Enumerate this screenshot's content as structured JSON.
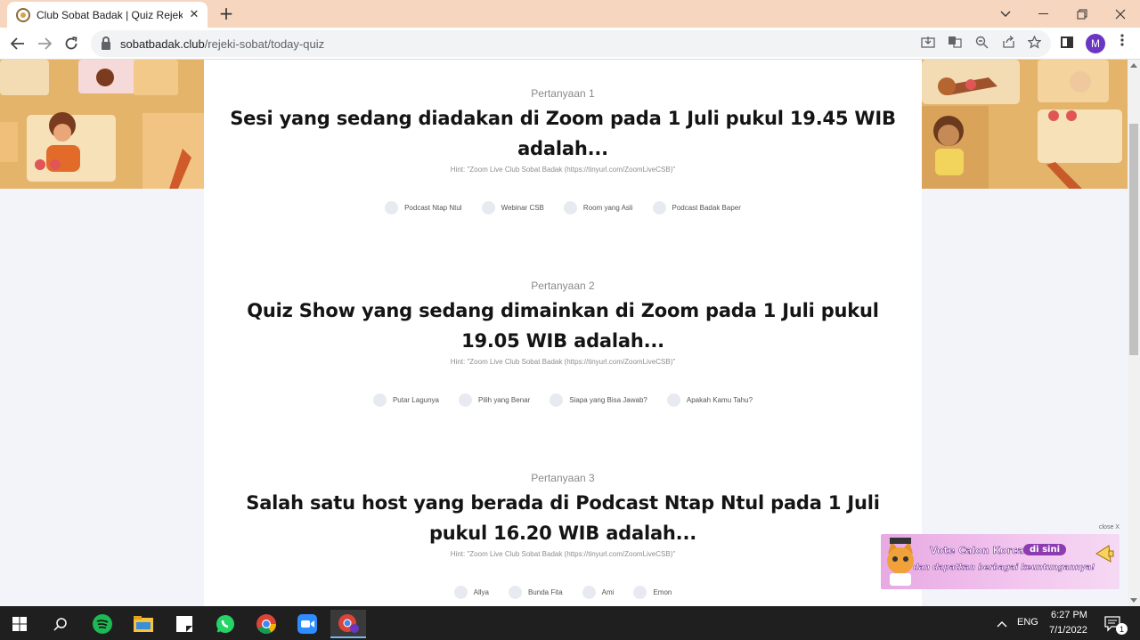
{
  "browser": {
    "tab_title": "Club Sobat Badak | Quiz Rejeki S",
    "tab_close": "✕",
    "new_tab": "+",
    "url_host": "sobatbadak.club",
    "url_path": "/rejeki-sobat/today-quiz",
    "profile_initial": "M"
  },
  "questions": [
    {
      "number": "Pertanyaan 1",
      "text": "Sesi yang sedang diadakan di Zoom pada 1 Juli pukul 19.45 WIB adalah...",
      "hint": "Hint: \"Zoom Live Club Sobat Badak (https://tinyurl.com/ZoomLiveCSB)\"",
      "options": [
        "Podcast Ntap Ntul",
        "Webinar CSB",
        "Room yang Asli",
        "Podcast Badak Baper"
      ]
    },
    {
      "number": "Pertanyaan 2",
      "text": "Quiz Show yang sedang dimainkan di Zoom pada 1 Juli pukul 19.05 WIB adalah...",
      "hint": "Hint: \"Zoom Live Club Sobat Badak (https://tinyurl.com/ZoomLiveCSB)\"",
      "options": [
        "Putar Lagunya",
        "Pilih yang Benar",
        "Siapa yang Bisa Jawab?",
        "Apakah Kamu Tahu?"
      ]
    },
    {
      "number": "Pertanyaan 3",
      "text": "Salah satu host yang berada di Podcast Ntap Ntul pada 1 Juli pukul 16.20 WIB adalah...",
      "hint": "Hint: \"Zoom Live Club Sobat Badak (https://tinyurl.com/ZoomLiveCSB)\"",
      "options": [
        "Allya",
        "Bunda Fita",
        "Ami",
        "Emon"
      ]
    }
  ],
  "ad": {
    "close_label": "close X",
    "line1": "Vote Calon Korcab",
    "pill": "di sini",
    "line2": "dan dapatkan berbagai keuntungannya!"
  },
  "taskbar": {
    "language": "ENG",
    "time": "6:27 PM",
    "date": "7/1/2022",
    "notification_count": "1"
  }
}
